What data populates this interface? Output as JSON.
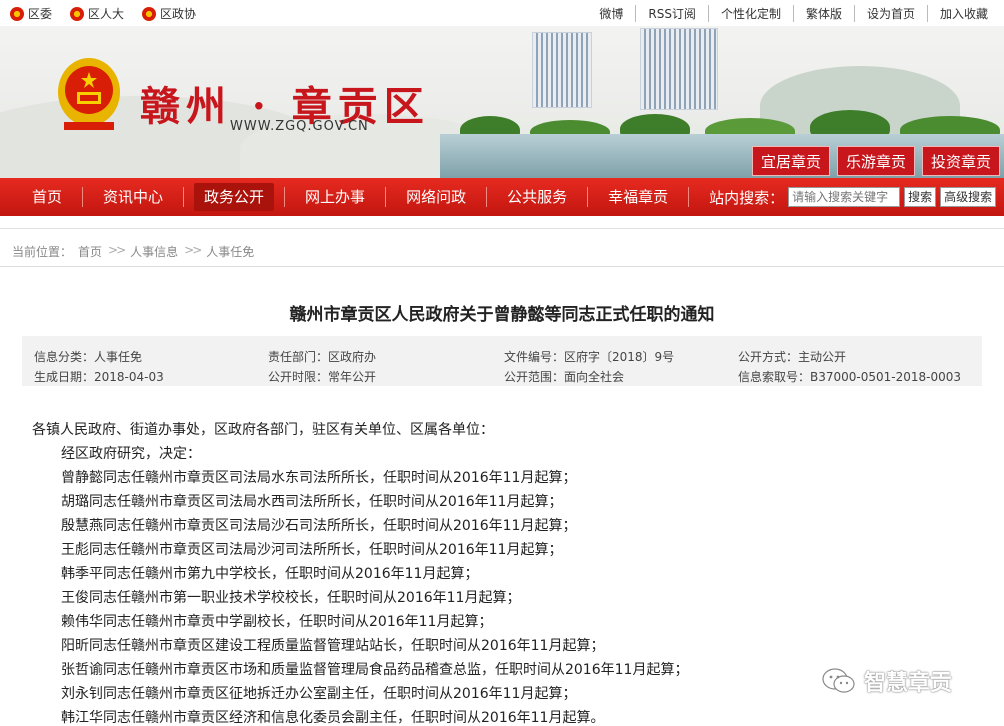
{
  "topbar": {
    "left": [
      {
        "label": "区委",
        "icon": "party-emblem-icon"
      },
      {
        "label": "区人大",
        "icon": "national-emblem-icon"
      },
      {
        "label": "区政协",
        "icon": "cppcc-emblem-icon"
      }
    ],
    "right": [
      "微博",
      "RSS订阅",
      "个性化定制",
      "繁体版",
      "设为首页",
      "加入收藏"
    ]
  },
  "banner": {
    "site_name": "赣州 · 章贡区",
    "url": "WWW.ZGQ.GOV.CN",
    "quick_links": [
      "宜居章贡",
      "乐游章贡",
      "投资章贡"
    ]
  },
  "nav": {
    "items": [
      "首页",
      "资讯中心",
      "政务公开",
      "网上办事",
      "网络问政",
      "公共服务",
      "幸福章贡"
    ],
    "active_index": 2,
    "search_label": "站内搜索：",
    "search_placeholder": "请输入搜索关键字",
    "search_button": "搜索",
    "advanced_button": "高级搜索"
  },
  "breadcrumb": {
    "label": "当前位置：",
    "items": [
      "首页",
      "人事信息",
      "人事任免"
    ],
    "separator": ">>"
  },
  "document": {
    "title": "赣州市章贡区人民政府关于曾静懿等同志正式任职的通知",
    "meta": {
      "category": "信息分类：人事任免",
      "department": "责任部门：区政府办",
      "file_no": "文件编号：区府字〔2018〕9号",
      "publicity": "公开方式：主动公开",
      "date": "生成日期：2018-04-03",
      "time_limit": "公开时限：常年公开",
      "scope": "公开范围：面向全社会",
      "index_no": "信息索取号：B37000-0501-2018-0003"
    },
    "lines": [
      "各镇人民政府、街道办事处，区政府各部门，驻区有关单位、区属各单位：",
      "经区政府研究，决定：",
      "曾静懿同志任赣州市章贡区司法局水东司法所所长，任职时间从2016年11月起算；",
      "胡璐同志任赣州市章贡区司法局水西司法所所长，任职时间从2016年11月起算；",
      "殷慧燕同志任赣州市章贡区司法局沙石司法所所长，任职时间从2016年11月起算；",
      "王彪同志任赣州市章贡区司法局沙河司法所所长，任职时间从2016年11月起算；",
      "韩季平同志任赣州市第九中学校长，任职时间从2016年11月起算；",
      "王俊同志任赣州市第一职业技术学校校长，任职时间从2016年11月起算；",
      "赖伟华同志任赣州市章贡中学副校长，任职时间从2016年11月起算；",
      "阳昕同志任赣州市章贡区建设工程质量监督管理站站长，任职时间从2016年11月起算；",
      "张哲谕同志任赣州市章贡区市场和质量监督管理局食品药品稽查总监，任职时间从2016年11月起算；",
      "刘永钊同志任赣州市章贡区征地拆迁办公室副主任，任职时间从2016年11月起算；",
      "韩江华同志任赣州市章贡区经济和信息化委员会副主任，任职时间从2016年11月起算。"
    ]
  },
  "watermark": {
    "text": "智慧章贡",
    "icon": "wechat-icon"
  },
  "colors": {
    "brand_red": "#c8161d",
    "nav_red": "#e62a20",
    "meta_bg": "#f2f2f2"
  }
}
